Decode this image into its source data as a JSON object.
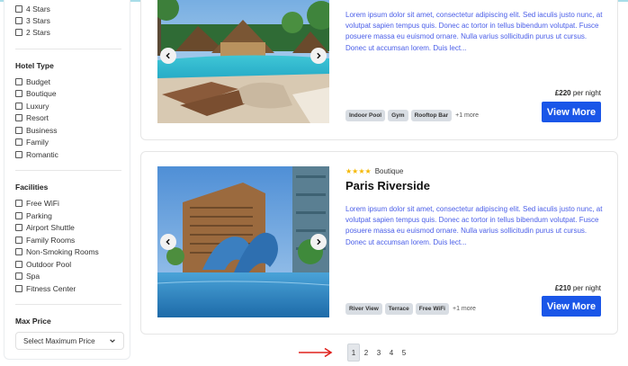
{
  "sidebar": {
    "star_rating": [
      {
        "label": "4 Stars"
      },
      {
        "label": "3 Stars"
      },
      {
        "label": "2 Stars"
      }
    ],
    "hotel_type": {
      "title": "Hotel Type",
      "items": [
        {
          "label": "Budget"
        },
        {
          "label": "Boutique"
        },
        {
          "label": "Luxury"
        },
        {
          "label": "Resort"
        },
        {
          "label": "Business"
        },
        {
          "label": "Family"
        },
        {
          "label": "Romantic"
        }
      ]
    },
    "facilities": {
      "title": "Facilities",
      "items": [
        {
          "label": "Free WiFi"
        },
        {
          "label": "Parking"
        },
        {
          "label": "Airport Shuttle"
        },
        {
          "label": "Family Rooms"
        },
        {
          "label": "Non-Smoking Rooms"
        },
        {
          "label": "Outdoor Pool"
        },
        {
          "label": "Spa"
        },
        {
          "label": "Fitness Center"
        }
      ]
    },
    "max_price": {
      "title": "Max Price",
      "selected": "Select Maximum Price"
    }
  },
  "hotels": [
    {
      "description": "Lorem ipsum dolor sit amet, consectetur adipiscing elit. Sed iaculis justo nunc, at volutpat sapien tempus quis. Donec ac tortor in tellus bibendum volutpat. Fusce posuere massa eu euismod ornare. Nulla varius sollicitudin purus ut cursus. Donec ut accumsan lorem. Duis lect...",
      "price": "£220",
      "price_suffix": "per night",
      "button": "View More",
      "tags": [
        "Indoor Pool",
        "Gym",
        "Rooftop Bar"
      ],
      "more": "+1 more"
    },
    {
      "stars": "★★★★",
      "type": "Boutique",
      "name": "Paris Riverside",
      "description": "Lorem ipsum dolor sit amet, consectetur adipiscing elit. Sed iaculis justo nunc, at volutpat sapien tempus quis. Donec ac tortor in tellus bibendum volutpat. Fusce posuere massa eu euismod ornare. Nulla varius sollicitudin purus ut cursus. Donec ut accumsan lorem. Duis lect...",
      "price": "£210",
      "price_suffix": "per night",
      "button": "View More",
      "tags": [
        "River View",
        "Terrace",
        "Free WiFi"
      ],
      "more": "+1 more"
    }
  ],
  "pagination": {
    "pages": [
      "1",
      "2",
      "3",
      "4",
      "5"
    ],
    "active": "1"
  },
  "colors": {
    "accent": "#1a56e8",
    "star": "#f5b800",
    "description_text": "#4a5ee8",
    "annotation_arrow": "#e0201b"
  },
  "icons": {
    "prev": "chevron-left-icon",
    "next": "chevron-right-icon",
    "select": "chevron-down-icon",
    "annotation": "red-arrow-icon"
  }
}
